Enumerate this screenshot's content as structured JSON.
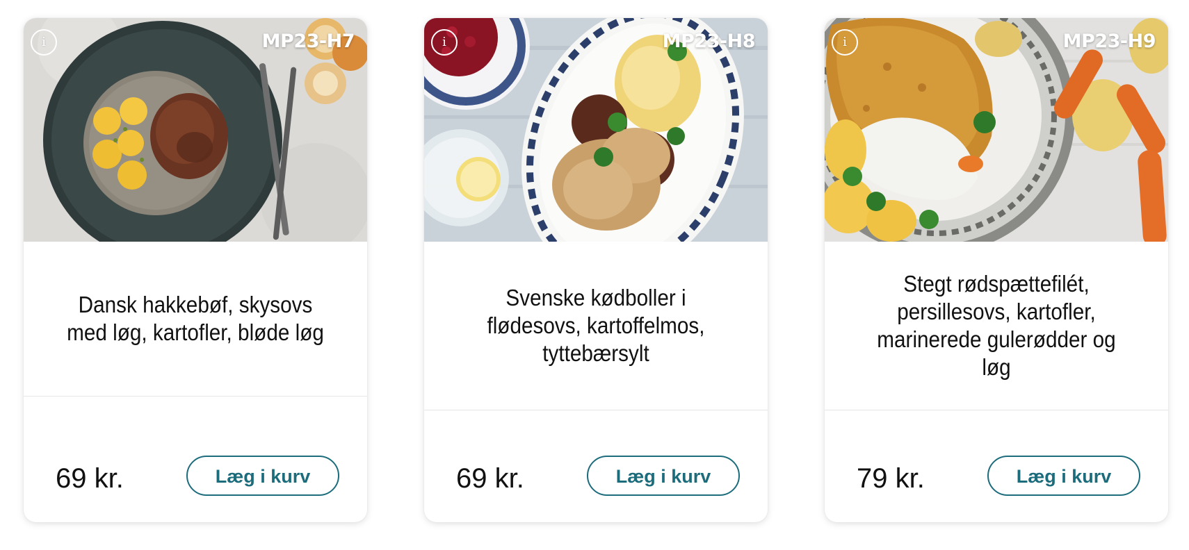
{
  "products": [
    {
      "sku": "MP23-H7",
      "title": "Dansk hakkebøf, skysovs med løg, kartofler, bløde løg",
      "price": "69 kr.",
      "cart_label": "Læg i kurv",
      "info_label": "i"
    },
    {
      "sku": "MP23-H8",
      "title": "Svenske kødboller i flødesovs, kartoffelmos, tyttebærsylt",
      "price": "69 kr.",
      "cart_label": "Læg i kurv",
      "info_label": "i"
    },
    {
      "sku": "MP23-H9",
      "title": "Stegt rødspættefilét, persillesovs, kartofler, marinerede gulerødder og løg",
      "price": "79 kr.",
      "cart_label": "Læg i kurv",
      "info_label": "i"
    }
  ],
  "colors": {
    "accent": "#1c6c7c",
    "text": "#111111",
    "divider": "#e6e6e6"
  },
  "icons": {
    "info": "info-icon"
  }
}
